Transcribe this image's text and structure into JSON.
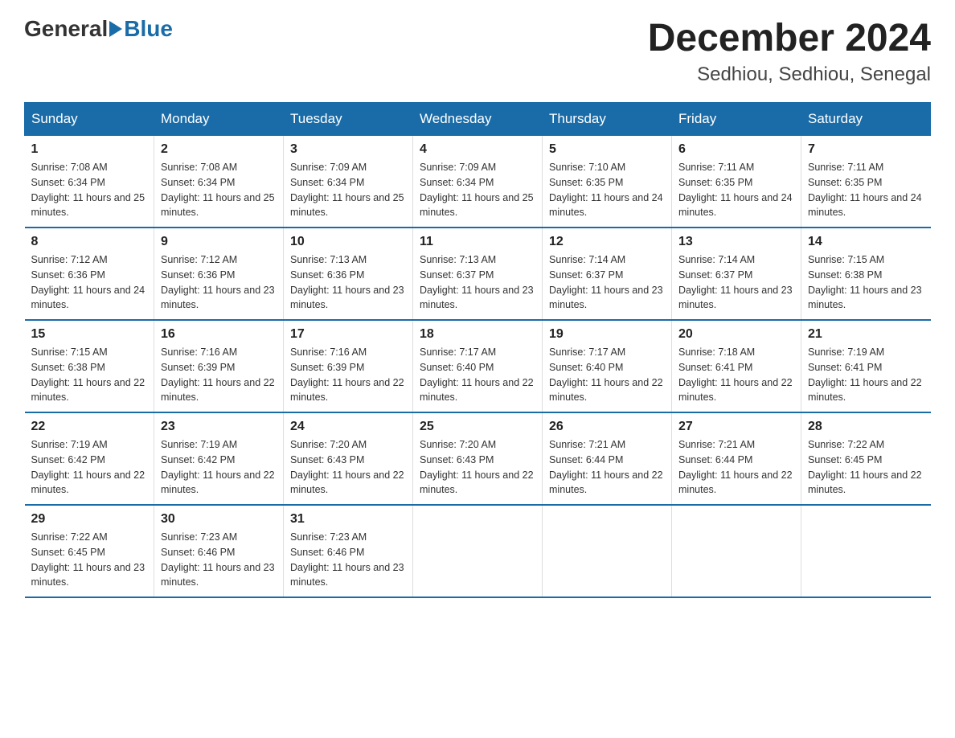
{
  "header": {
    "logo_general": "General",
    "logo_blue": "Blue",
    "month_title": "December 2024",
    "location": "Sedhiou, Sedhiou, Senegal"
  },
  "days_of_week": [
    "Sunday",
    "Monday",
    "Tuesday",
    "Wednesday",
    "Thursday",
    "Friday",
    "Saturday"
  ],
  "weeks": [
    [
      {
        "day": "1",
        "sunrise": "7:08 AM",
        "sunset": "6:34 PM",
        "daylight": "11 hours and 25 minutes."
      },
      {
        "day": "2",
        "sunrise": "7:08 AM",
        "sunset": "6:34 PM",
        "daylight": "11 hours and 25 minutes."
      },
      {
        "day": "3",
        "sunrise": "7:09 AM",
        "sunset": "6:34 PM",
        "daylight": "11 hours and 25 minutes."
      },
      {
        "day": "4",
        "sunrise": "7:09 AM",
        "sunset": "6:34 PM",
        "daylight": "11 hours and 25 minutes."
      },
      {
        "day": "5",
        "sunrise": "7:10 AM",
        "sunset": "6:35 PM",
        "daylight": "11 hours and 24 minutes."
      },
      {
        "day": "6",
        "sunrise": "7:11 AM",
        "sunset": "6:35 PM",
        "daylight": "11 hours and 24 minutes."
      },
      {
        "day": "7",
        "sunrise": "7:11 AM",
        "sunset": "6:35 PM",
        "daylight": "11 hours and 24 minutes."
      }
    ],
    [
      {
        "day": "8",
        "sunrise": "7:12 AM",
        "sunset": "6:36 PM",
        "daylight": "11 hours and 24 minutes."
      },
      {
        "day": "9",
        "sunrise": "7:12 AM",
        "sunset": "6:36 PM",
        "daylight": "11 hours and 23 minutes."
      },
      {
        "day": "10",
        "sunrise": "7:13 AM",
        "sunset": "6:36 PM",
        "daylight": "11 hours and 23 minutes."
      },
      {
        "day": "11",
        "sunrise": "7:13 AM",
        "sunset": "6:37 PM",
        "daylight": "11 hours and 23 minutes."
      },
      {
        "day": "12",
        "sunrise": "7:14 AM",
        "sunset": "6:37 PM",
        "daylight": "11 hours and 23 minutes."
      },
      {
        "day": "13",
        "sunrise": "7:14 AM",
        "sunset": "6:37 PM",
        "daylight": "11 hours and 23 minutes."
      },
      {
        "day": "14",
        "sunrise": "7:15 AM",
        "sunset": "6:38 PM",
        "daylight": "11 hours and 23 minutes."
      }
    ],
    [
      {
        "day": "15",
        "sunrise": "7:15 AM",
        "sunset": "6:38 PM",
        "daylight": "11 hours and 22 minutes."
      },
      {
        "day": "16",
        "sunrise": "7:16 AM",
        "sunset": "6:39 PM",
        "daylight": "11 hours and 22 minutes."
      },
      {
        "day": "17",
        "sunrise": "7:16 AM",
        "sunset": "6:39 PM",
        "daylight": "11 hours and 22 minutes."
      },
      {
        "day": "18",
        "sunrise": "7:17 AM",
        "sunset": "6:40 PM",
        "daylight": "11 hours and 22 minutes."
      },
      {
        "day": "19",
        "sunrise": "7:17 AM",
        "sunset": "6:40 PM",
        "daylight": "11 hours and 22 minutes."
      },
      {
        "day": "20",
        "sunrise": "7:18 AM",
        "sunset": "6:41 PM",
        "daylight": "11 hours and 22 minutes."
      },
      {
        "day": "21",
        "sunrise": "7:19 AM",
        "sunset": "6:41 PM",
        "daylight": "11 hours and 22 minutes."
      }
    ],
    [
      {
        "day": "22",
        "sunrise": "7:19 AM",
        "sunset": "6:42 PM",
        "daylight": "11 hours and 22 minutes."
      },
      {
        "day": "23",
        "sunrise": "7:19 AM",
        "sunset": "6:42 PM",
        "daylight": "11 hours and 22 minutes."
      },
      {
        "day": "24",
        "sunrise": "7:20 AM",
        "sunset": "6:43 PM",
        "daylight": "11 hours and 22 minutes."
      },
      {
        "day": "25",
        "sunrise": "7:20 AM",
        "sunset": "6:43 PM",
        "daylight": "11 hours and 22 minutes."
      },
      {
        "day": "26",
        "sunrise": "7:21 AM",
        "sunset": "6:44 PM",
        "daylight": "11 hours and 22 minutes."
      },
      {
        "day": "27",
        "sunrise": "7:21 AM",
        "sunset": "6:44 PM",
        "daylight": "11 hours and 22 minutes."
      },
      {
        "day": "28",
        "sunrise": "7:22 AM",
        "sunset": "6:45 PM",
        "daylight": "11 hours and 22 minutes."
      }
    ],
    [
      {
        "day": "29",
        "sunrise": "7:22 AM",
        "sunset": "6:45 PM",
        "daylight": "11 hours and 23 minutes."
      },
      {
        "day": "30",
        "sunrise": "7:23 AM",
        "sunset": "6:46 PM",
        "daylight": "11 hours and 23 minutes."
      },
      {
        "day": "31",
        "sunrise": "7:23 AM",
        "sunset": "6:46 PM",
        "daylight": "11 hours and 23 minutes."
      },
      null,
      null,
      null,
      null
    ]
  ]
}
